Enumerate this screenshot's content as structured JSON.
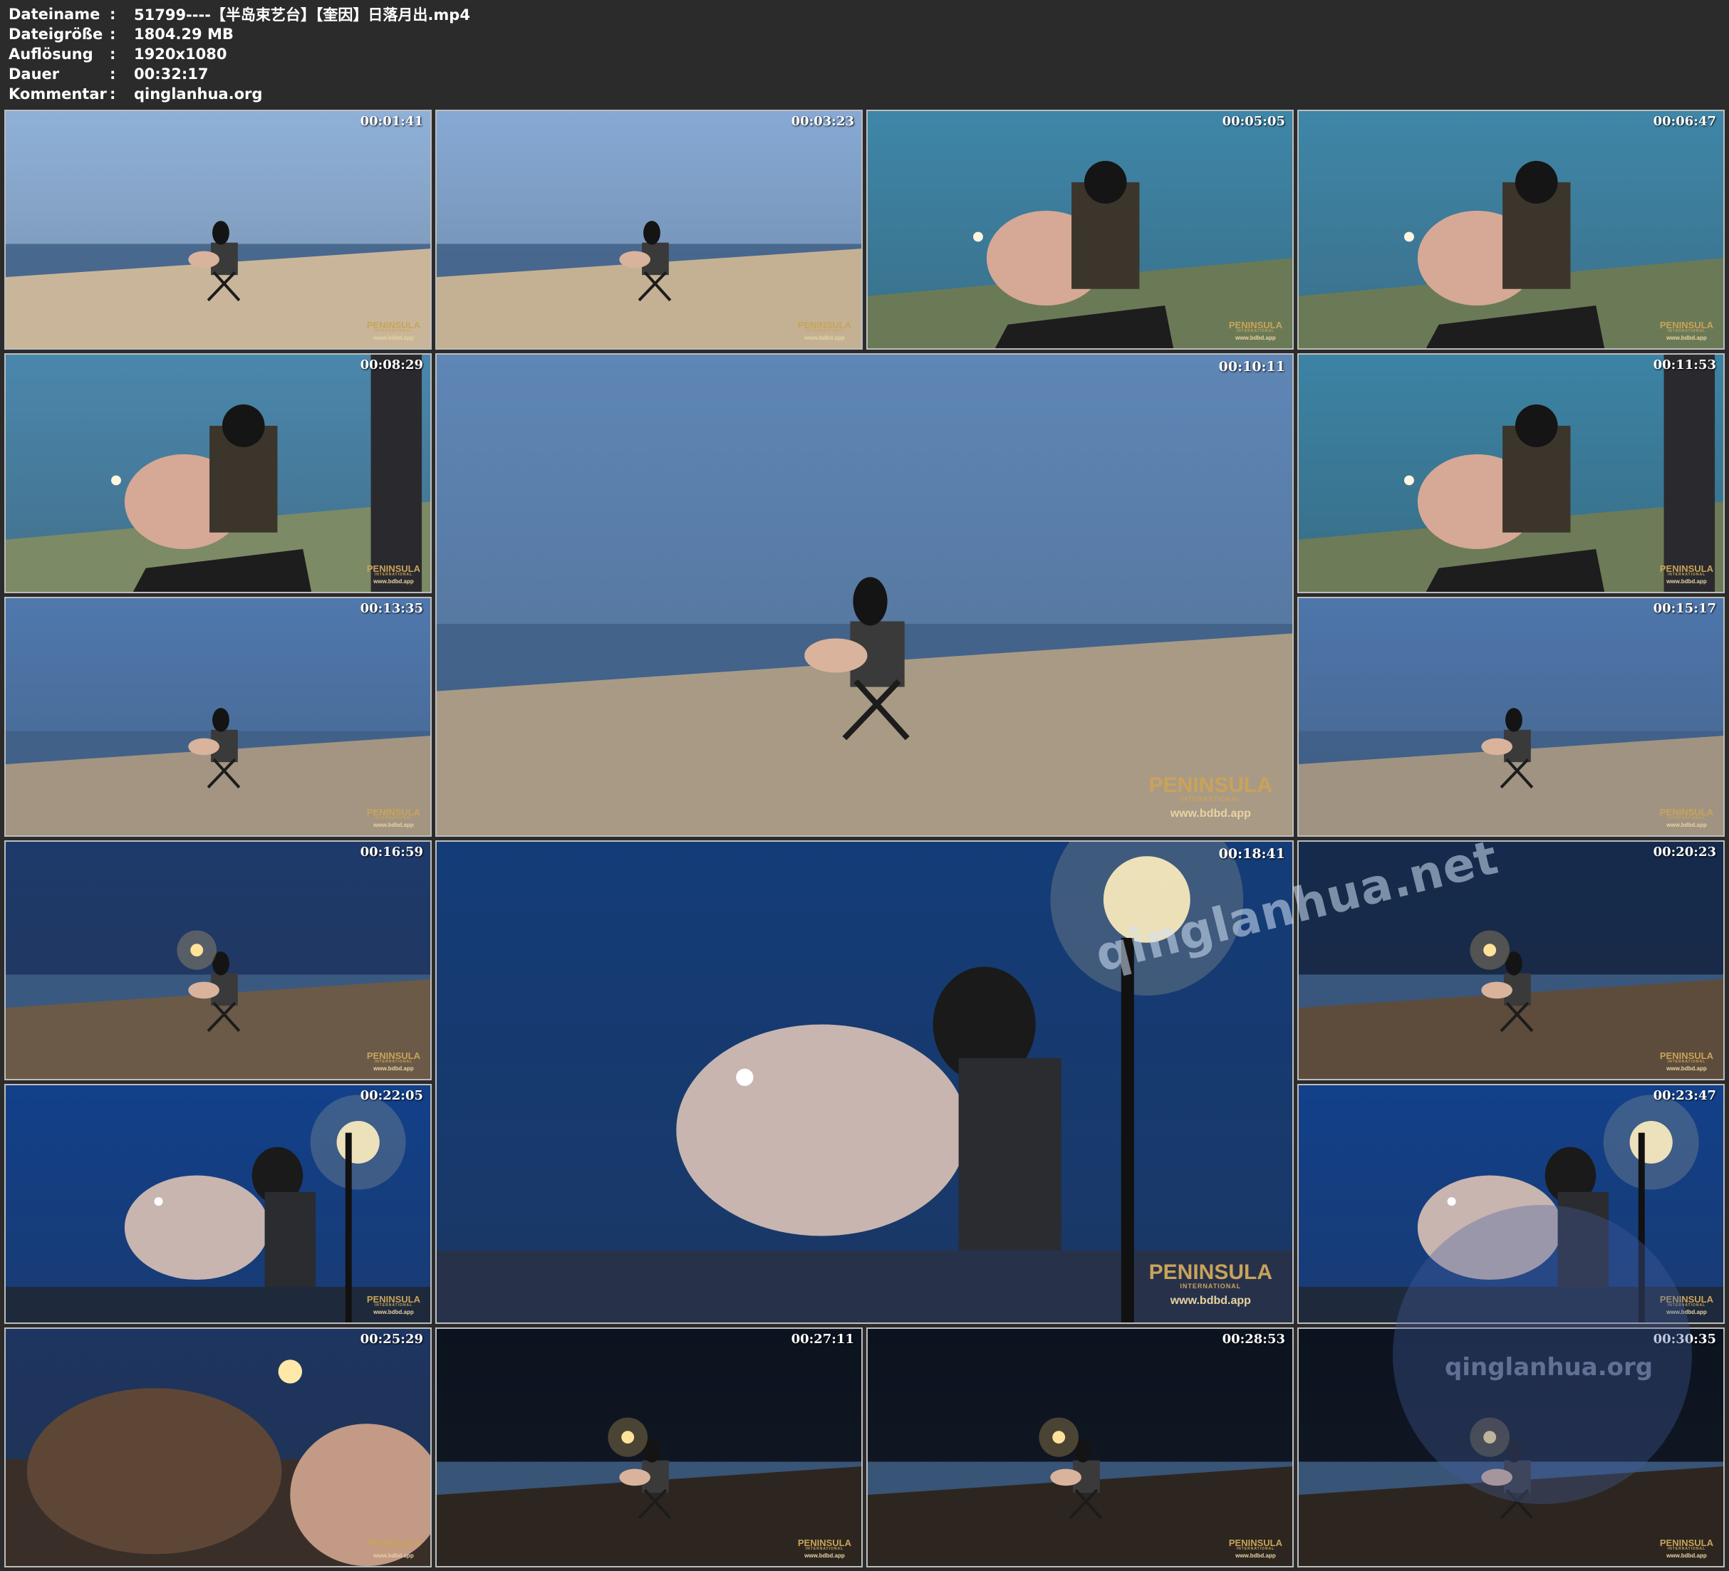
{
  "file_info": [
    {
      "key": "Dateiname",
      "sep": ":",
      "value": "51799----【半岛束艺台】【奎因】日落月出.mp4"
    },
    {
      "key": "Dateigröße",
      "sep": ":",
      "value": "1804.29 MB"
    },
    {
      "key": "Auflösung",
      "sep": ":",
      "value": "1920x1080"
    },
    {
      "key": "Dauer",
      "sep": ":",
      "value": "00:32:17"
    },
    {
      "key": "Kommentar",
      "sep": ":",
      "value": "qinglanhua.org"
    }
  ],
  "logo": {
    "brand": "PENINSULA",
    "sub": "INTERNATIONAL",
    "site": "www.bdbd.app"
  },
  "watermark_text": "qinglanhua.net",
  "watermark_circle_text": "qinglanhua.org",
  "thumbnails": [
    {
      "time": "00:01:41",
      "scene": "dusk-beach-far",
      "sky": "#8fb1d8",
      "ground": "#c9b69a"
    },
    {
      "time": "00:03:23",
      "scene": "dusk-beach-far",
      "sky": "#86a9d4",
      "ground": "#c4b194"
    },
    {
      "time": "00:05:05",
      "scene": "close-moon",
      "sky": "#3e86a8",
      "ground": "#6b7a56"
    },
    {
      "time": "00:06:47",
      "scene": "close-moon",
      "sky": "#3f86a8",
      "ground": "#6b7a56"
    },
    {
      "time": "00:08:29",
      "scene": "close-moon-person",
      "sky": "#4a87ac",
      "ground": "#7d8a66"
    },
    {
      "time": "00:10:11",
      "scene": "big-beach",
      "sky": "#5e86b6",
      "ground": "#a99a86"
    },
    {
      "time": "00:11:53",
      "scene": "close-moon-person",
      "sky": "#3c83a4",
      "ground": "#6e7b58"
    },
    {
      "time": "00:13:35",
      "scene": "dusk-beach-far",
      "sky": "#4f78ad",
      "ground": "#a39582"
    },
    {
      "time": "00:15:17",
      "scene": "dusk-beach-far",
      "sky": "#4e76ab",
      "ground": "#a09382"
    },
    {
      "time": "00:16:59",
      "scene": "night-lamp-far",
      "sky": "#1e3a6b",
      "ground": "#6b5a47"
    },
    {
      "time": "00:18:41",
      "scene": "big-lamp",
      "sky": "#143c78",
      "ground": "#27324a"
    },
    {
      "time": "00:20:23",
      "scene": "night-lamp-far",
      "sky": "#152a4c",
      "ground": "#5d4c3c"
    },
    {
      "time": "00:22:05",
      "scene": "close-lamp",
      "sky": "#12408a",
      "ground": "#1e2a3c"
    },
    {
      "time": "00:23:47",
      "scene": "close-lamp",
      "sky": "#12408a",
      "ground": "#1e2a3c"
    },
    {
      "time": "00:25:29",
      "scene": "closeup-dark",
      "sky": "#1d3560",
      "ground": "#3a2e28"
    },
    {
      "time": "00:27:11",
      "scene": "night-dark",
      "sky": "#0b1320",
      "ground": "#2d2620"
    },
    {
      "time": "00:28:53",
      "scene": "night-dark",
      "sky": "#0b1320",
      "ground": "#2d2620"
    },
    {
      "time": "00:30:35",
      "scene": "night-dark",
      "sky": "#0b1320",
      "ground": "#2d2620"
    }
  ]
}
